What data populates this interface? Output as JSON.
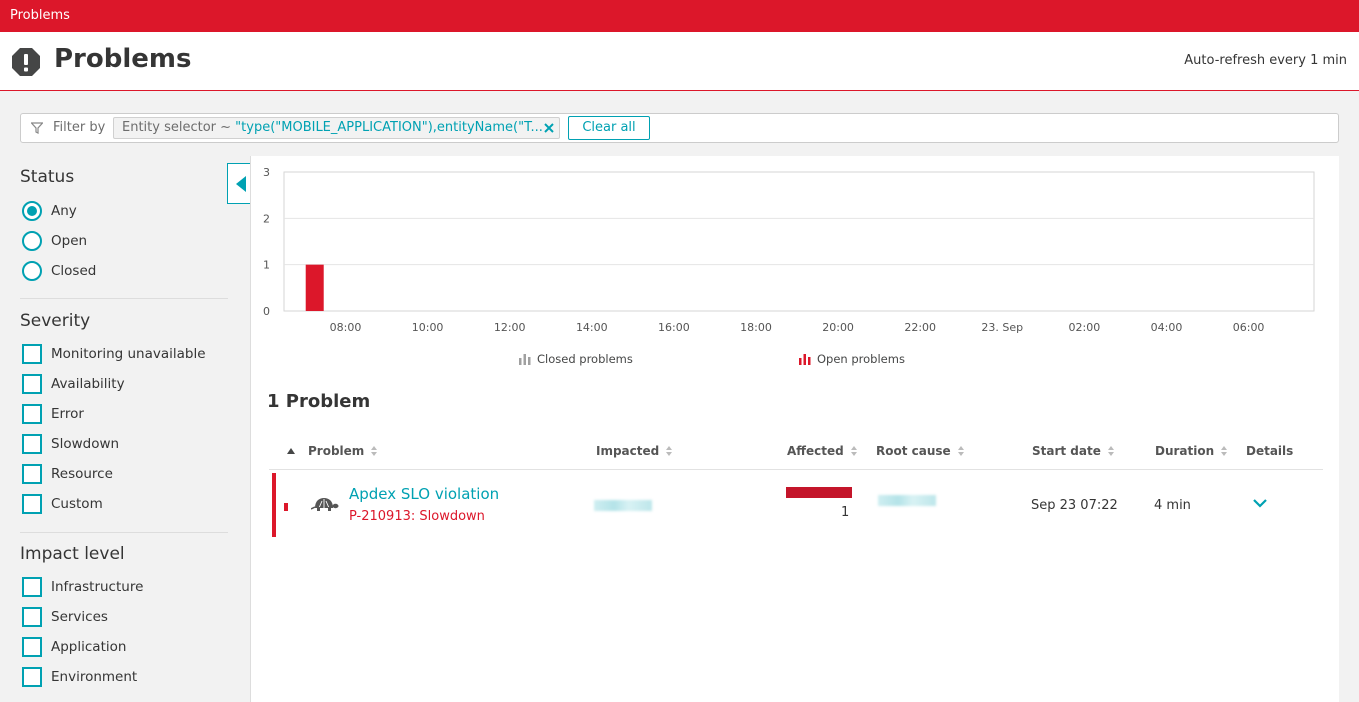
{
  "topbar": {
    "label": "Problems"
  },
  "header": {
    "title": "Problems",
    "refresh": "Auto-refresh every 1 min"
  },
  "filter": {
    "label": "Filter by",
    "chip_key": "Entity selector ~ ",
    "chip_value": "\"type(\"MOBILE_APPLICATION\"),entityName(\"T...",
    "clear_all": "Clear all"
  },
  "sidebar": {
    "status": {
      "title": "Status",
      "options": [
        "Any",
        "Open",
        "Closed"
      ],
      "selected": "Any"
    },
    "severity": {
      "title": "Severity",
      "options": [
        "Monitoring unavailable",
        "Availability",
        "Error",
        "Slowdown",
        "Resource",
        "Custom"
      ]
    },
    "impact": {
      "title": "Impact level",
      "options": [
        "Infrastructure",
        "Services",
        "Application",
        "Environment"
      ]
    }
  },
  "chart_data": {
    "type": "bar",
    "categories": [
      "08:00",
      "10:00",
      "12:00",
      "14:00",
      "16:00",
      "18:00",
      "20:00",
      "22:00",
      "23. Sep",
      "02:00",
      "04:00",
      "06:00"
    ],
    "series": [
      {
        "name": "Closed problems",
        "color": "#a0a0a0",
        "points": []
      },
      {
        "name": "Open problems",
        "color": "#dc172a",
        "points": [
          {
            "x": "07:15",
            "value": 1
          }
        ]
      }
    ],
    "ylim": [
      0,
      3
    ],
    "yticks": [
      0,
      1,
      2,
      3
    ],
    "grid": true,
    "legend_position": "bottom"
  },
  "problems": {
    "count_title": "1 Problem",
    "columns": [
      "Problem",
      "Impacted",
      "Affected",
      "Root cause",
      "Start date",
      "Duration",
      "Details"
    ],
    "rows": [
      {
        "title": "Apdex SLO violation",
        "subtitle": "P-210913: Slowdown",
        "icon": "turtle-icon",
        "affected": "1",
        "start_date": "Sep 23 07:22",
        "duration": "4 min"
      }
    ]
  },
  "colors": {
    "accent": "#00a1b2",
    "brand_red": "#dc172a"
  }
}
